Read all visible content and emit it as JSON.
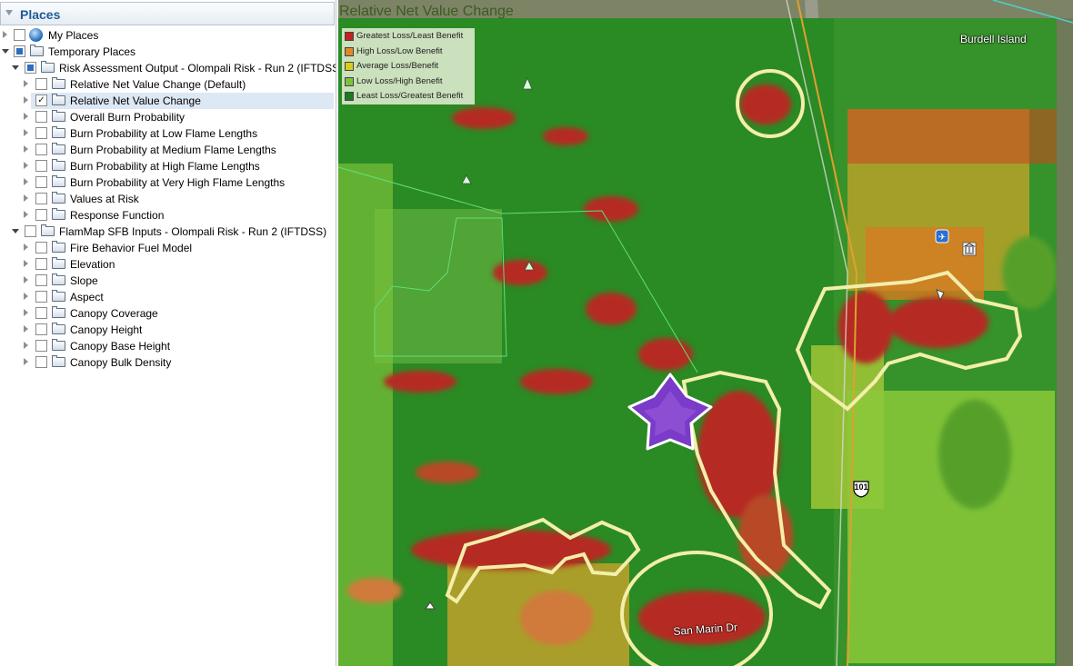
{
  "places_panel": {
    "title": "Places",
    "items": [
      {
        "label": "My Places"
      },
      {
        "label": "Temporary Places"
      },
      {
        "label": "Risk Assessment Output - Olompali Risk - Run 2 (IFTDSS)"
      },
      {
        "label": "Relative Net Value Change (Default)"
      },
      {
        "label": "Relative Net Value Change",
        "checked": true,
        "selected": true
      },
      {
        "label": "Overall Burn Probability"
      },
      {
        "label": "Burn Probability at Low Flame Lengths"
      },
      {
        "label": "Burn Probability at Medium Flame Lengths"
      },
      {
        "label": "Burn Probability at High Flame Lengths"
      },
      {
        "label": "Burn Probability at Very High Flame Lengths"
      },
      {
        "label": "Values at Risk"
      },
      {
        "label": "Response Function"
      },
      {
        "label": "FlamMap SFB Inputs - Olompali Risk - Run 2 (IFTDSS)"
      },
      {
        "label": "Fire Behavior Fuel Model"
      },
      {
        "label": "Elevation"
      },
      {
        "label": "Slope"
      },
      {
        "label": "Aspect"
      },
      {
        "label": "Canopy Coverage"
      },
      {
        "label": "Canopy Height"
      },
      {
        "label": "Canopy Base Height"
      },
      {
        "label": "Canopy Bulk Density"
      }
    ]
  },
  "map": {
    "title": "Relative Net Value Change",
    "legend": [
      {
        "label": "Greatest Loss/Least Benefit",
        "color": "#c42020"
      },
      {
        "label": "High Loss/Low Benefit",
        "color": "#e08a26"
      },
      {
        "label": "Average Loss/Benefit",
        "color": "#d8cc1c"
      },
      {
        "label": "Low Loss/High Benefit",
        "color": "#7cc23a"
      },
      {
        "label": "Least Loss/Greatest Benefit",
        "color": "#1e7a1e"
      }
    ],
    "place_label": "Burdell Island",
    "road_label": "San Marin Dr",
    "highway_shield": "101"
  }
}
